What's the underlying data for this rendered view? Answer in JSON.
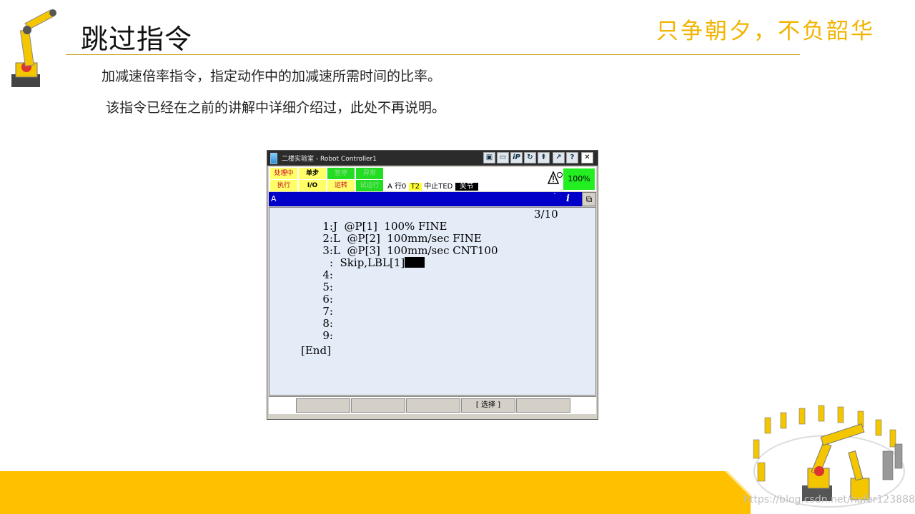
{
  "slide": {
    "title": "跳过指令",
    "slogan": "只争朝夕，不负韶华",
    "desc_1": "加减速倍率指令，指定动作中的加减速所需时间的比率。",
    "desc_2": "该指令已经在之前的讲解中详细介绍过，此处不再说明。",
    "watermark": "https://blog.csdn.net/hafer123888"
  },
  "colors": {
    "accent": "#f2b400",
    "band": "#ffc000",
    "prog_bar": "#0000c8",
    "editor_bg": "#e4ecf8",
    "override": "#22ee22"
  },
  "pendant": {
    "window_title": "二楼实验室 - Robot Controller1",
    "toolbar": [
      {
        "name": "teach-pendant-icon",
        "glyph": "▣"
      },
      {
        "name": "keyboard-icon",
        "glyph": "▭"
      },
      {
        "name": "ip-icon",
        "glyph": "iP"
      },
      {
        "name": "rotate-icon",
        "glyph": "↻"
      },
      {
        "name": "emergency-icon",
        "glyph": "⇞"
      },
      {
        "name": "jog-icon",
        "glyph": "↗"
      },
      {
        "name": "help-icon",
        "glyph": "?"
      },
      {
        "name": "close-icon",
        "glyph": "✕"
      }
    ],
    "status": {
      "busy": "处理中",
      "step": "单步",
      "hold": "暂停",
      "fault": "异常",
      "run": "执行",
      "io": "I/O",
      "prod": "运转",
      "tcyc": "试运行",
      "line_text": "A   行0",
      "mode": "T2",
      "state": "中止TED",
      "joint": "关节",
      "override": "100%"
    },
    "program": {
      "name": "A",
      "line_counter": "3/10",
      "lines": [
        {
          "num": "1:",
          "code": "J  @P[1]  100% FINE"
        },
        {
          "num": "2:",
          "code": "L  @P[2]  100mm/sec FINE"
        },
        {
          "num": "3:",
          "code": "L  @P[3]  100mm/sec CNT100"
        },
        {
          "num": ":",
          "code": "  Skip,LBL[1]"
        },
        {
          "num": "4:",
          "code": ""
        },
        {
          "num": "5:",
          "code": ""
        },
        {
          "num": "6:",
          "code": ""
        },
        {
          "num": "7:",
          "code": ""
        },
        {
          "num": "8:",
          "code": ""
        },
        {
          "num": "9:",
          "code": ""
        }
      ],
      "end": "[End]"
    },
    "fkeys": [
      "",
      "",
      "",
      "[ 选择 ]",
      ""
    ]
  }
}
